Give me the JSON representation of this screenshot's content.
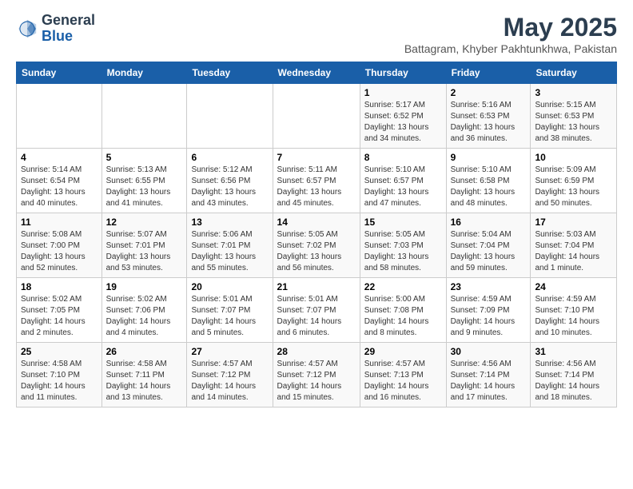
{
  "logo": {
    "general": "General",
    "blue": "Blue"
  },
  "header": {
    "month_year": "May 2025",
    "location": "Battagram, Khyber Pakhtunkhwa, Pakistan"
  },
  "days_of_week": [
    "Sunday",
    "Monday",
    "Tuesday",
    "Wednesday",
    "Thursday",
    "Friday",
    "Saturday"
  ],
  "weeks": [
    [
      {
        "day": "",
        "info": ""
      },
      {
        "day": "",
        "info": ""
      },
      {
        "day": "",
        "info": ""
      },
      {
        "day": "",
        "info": ""
      },
      {
        "day": "1",
        "info": "Sunrise: 5:17 AM\nSunset: 6:52 PM\nDaylight: 13 hours\nand 34 minutes."
      },
      {
        "day": "2",
        "info": "Sunrise: 5:16 AM\nSunset: 6:53 PM\nDaylight: 13 hours\nand 36 minutes."
      },
      {
        "day": "3",
        "info": "Sunrise: 5:15 AM\nSunset: 6:53 PM\nDaylight: 13 hours\nand 38 minutes."
      }
    ],
    [
      {
        "day": "4",
        "info": "Sunrise: 5:14 AM\nSunset: 6:54 PM\nDaylight: 13 hours\nand 40 minutes."
      },
      {
        "day": "5",
        "info": "Sunrise: 5:13 AM\nSunset: 6:55 PM\nDaylight: 13 hours\nand 41 minutes."
      },
      {
        "day": "6",
        "info": "Sunrise: 5:12 AM\nSunset: 6:56 PM\nDaylight: 13 hours\nand 43 minutes."
      },
      {
        "day": "7",
        "info": "Sunrise: 5:11 AM\nSunset: 6:57 PM\nDaylight: 13 hours\nand 45 minutes."
      },
      {
        "day": "8",
        "info": "Sunrise: 5:10 AM\nSunset: 6:57 PM\nDaylight: 13 hours\nand 47 minutes."
      },
      {
        "day": "9",
        "info": "Sunrise: 5:10 AM\nSunset: 6:58 PM\nDaylight: 13 hours\nand 48 minutes."
      },
      {
        "day": "10",
        "info": "Sunrise: 5:09 AM\nSunset: 6:59 PM\nDaylight: 13 hours\nand 50 minutes."
      }
    ],
    [
      {
        "day": "11",
        "info": "Sunrise: 5:08 AM\nSunset: 7:00 PM\nDaylight: 13 hours\nand 52 minutes."
      },
      {
        "day": "12",
        "info": "Sunrise: 5:07 AM\nSunset: 7:01 PM\nDaylight: 13 hours\nand 53 minutes."
      },
      {
        "day": "13",
        "info": "Sunrise: 5:06 AM\nSunset: 7:01 PM\nDaylight: 13 hours\nand 55 minutes."
      },
      {
        "day": "14",
        "info": "Sunrise: 5:05 AM\nSunset: 7:02 PM\nDaylight: 13 hours\nand 56 minutes."
      },
      {
        "day": "15",
        "info": "Sunrise: 5:05 AM\nSunset: 7:03 PM\nDaylight: 13 hours\nand 58 minutes."
      },
      {
        "day": "16",
        "info": "Sunrise: 5:04 AM\nSunset: 7:04 PM\nDaylight: 13 hours\nand 59 minutes."
      },
      {
        "day": "17",
        "info": "Sunrise: 5:03 AM\nSunset: 7:04 PM\nDaylight: 14 hours\nand 1 minute."
      }
    ],
    [
      {
        "day": "18",
        "info": "Sunrise: 5:02 AM\nSunset: 7:05 PM\nDaylight: 14 hours\nand 2 minutes."
      },
      {
        "day": "19",
        "info": "Sunrise: 5:02 AM\nSunset: 7:06 PM\nDaylight: 14 hours\nand 4 minutes."
      },
      {
        "day": "20",
        "info": "Sunrise: 5:01 AM\nSunset: 7:07 PM\nDaylight: 14 hours\nand 5 minutes."
      },
      {
        "day": "21",
        "info": "Sunrise: 5:01 AM\nSunset: 7:07 PM\nDaylight: 14 hours\nand 6 minutes."
      },
      {
        "day": "22",
        "info": "Sunrise: 5:00 AM\nSunset: 7:08 PM\nDaylight: 14 hours\nand 8 minutes."
      },
      {
        "day": "23",
        "info": "Sunrise: 4:59 AM\nSunset: 7:09 PM\nDaylight: 14 hours\nand 9 minutes."
      },
      {
        "day": "24",
        "info": "Sunrise: 4:59 AM\nSunset: 7:10 PM\nDaylight: 14 hours\nand 10 minutes."
      }
    ],
    [
      {
        "day": "25",
        "info": "Sunrise: 4:58 AM\nSunset: 7:10 PM\nDaylight: 14 hours\nand 11 minutes."
      },
      {
        "day": "26",
        "info": "Sunrise: 4:58 AM\nSunset: 7:11 PM\nDaylight: 14 hours\nand 13 minutes."
      },
      {
        "day": "27",
        "info": "Sunrise: 4:57 AM\nSunset: 7:12 PM\nDaylight: 14 hours\nand 14 minutes."
      },
      {
        "day": "28",
        "info": "Sunrise: 4:57 AM\nSunset: 7:12 PM\nDaylight: 14 hours\nand 15 minutes."
      },
      {
        "day": "29",
        "info": "Sunrise: 4:57 AM\nSunset: 7:13 PM\nDaylight: 14 hours\nand 16 minutes."
      },
      {
        "day": "30",
        "info": "Sunrise: 4:56 AM\nSunset: 7:14 PM\nDaylight: 14 hours\nand 17 minutes."
      },
      {
        "day": "31",
        "info": "Sunrise: 4:56 AM\nSunset: 7:14 PM\nDaylight: 14 hours\nand 18 minutes."
      }
    ]
  ]
}
